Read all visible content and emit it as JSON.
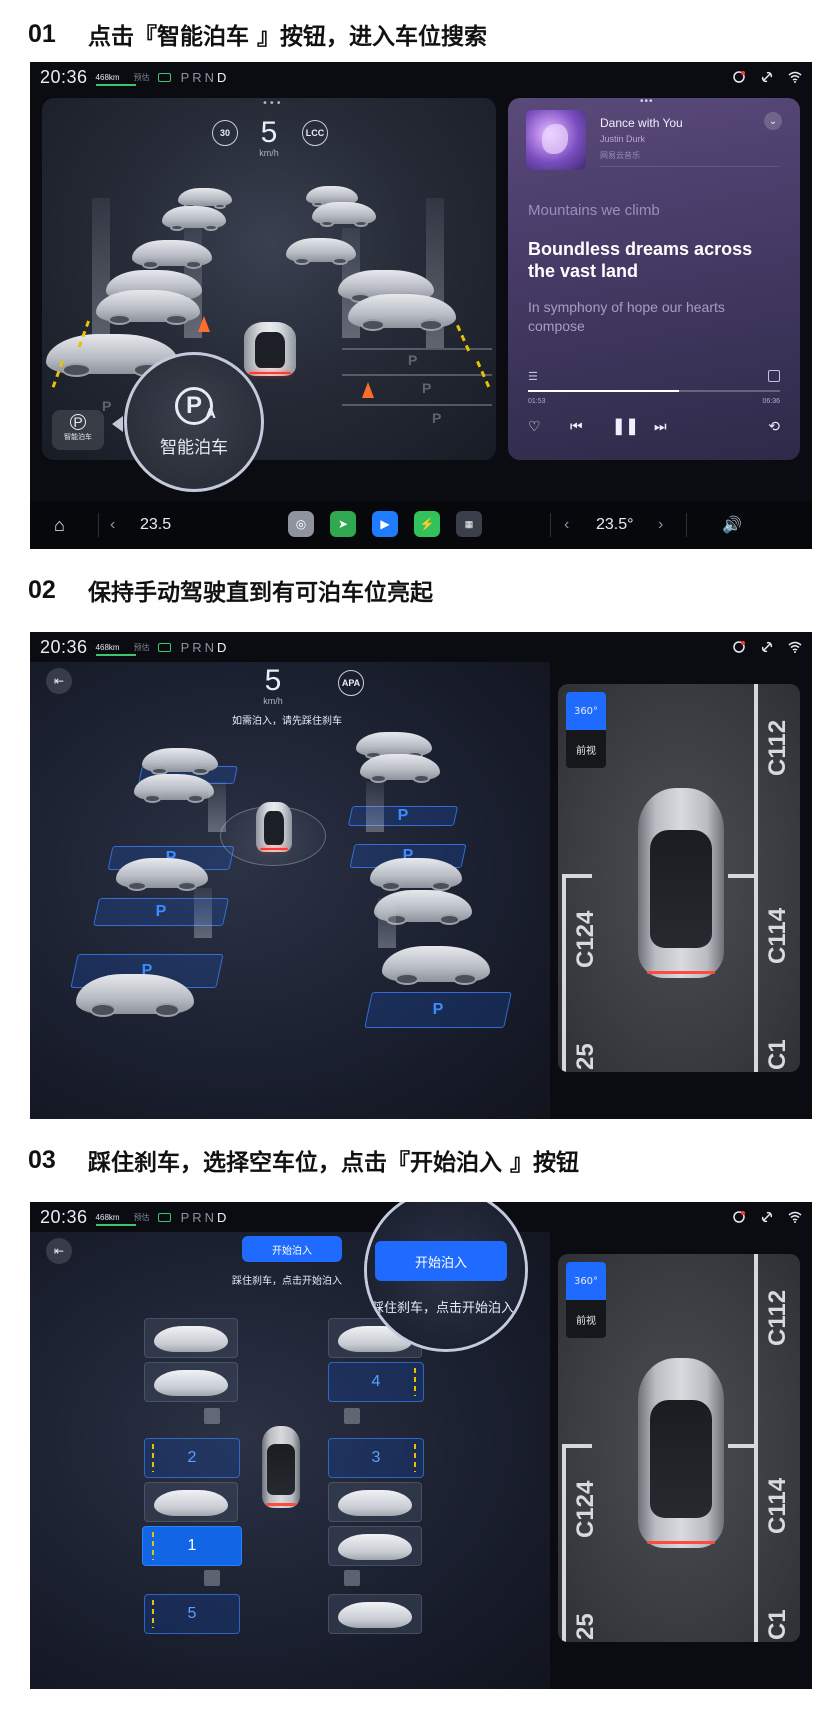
{
  "steps": [
    {
      "num": "01",
      "title": "点击『智能泊车 』按钮，进入车位搜索"
    },
    {
      "num": "02",
      "title": "保持手动驾驶直到有可泊车位亮起"
    },
    {
      "num": "03",
      "title": "踩住刹车，选择空车位，点击『开始泊入 』按钮"
    }
  ],
  "statusbar": {
    "clock": "20:36",
    "range": "468km",
    "estimate": "预估",
    "gears": [
      "P",
      "R",
      "N",
      "D"
    ],
    "active_gear": "D"
  },
  "screen1": {
    "speed": "5",
    "speed_unit": "km/h",
    "speed_limit": "30",
    "lcc_label": "LCC",
    "park_button_small_label": "智能泊车",
    "park_button_zoom_label": "智能泊车",
    "park_icon_letters": "P",
    "park_icon_sub": "A",
    "music": {
      "title": "Dance with You",
      "artist": "Justin Durk",
      "source": "网易云音乐",
      "lyric_prev": "Mountains we climb",
      "lyric_current": "Boundless dreams across the vast land",
      "lyric_next": "In symphony of hope our hearts compose",
      "elapsed": "01:53",
      "total": "06:36",
      "progress": 0.6
    },
    "bottom": {
      "temp_left": "23.5",
      "temp_right": "23.5°"
    }
  },
  "screen2": {
    "speed": "5",
    "speed_unit": "km/h",
    "apa_label": "APA",
    "hint": "如需泊入，请先踩住刹车",
    "cam_tab_360": "360°",
    "cam_tab_front": "前视",
    "cam_labels": [
      "C112",
      "C124",
      "C114",
      "25",
      "C1"
    ],
    "slot_letter": "P"
  },
  "screen3": {
    "start_button": "开始泊入",
    "hint": "踩住刹车，点击开始泊入",
    "zoom_button": "开始泊入",
    "zoom_hint": "踩住刹车，点击开始泊入",
    "cam_tab_360": "360°",
    "cam_tab_front": "前视",
    "cam_labels": [
      "C112",
      "C124",
      "C114",
      "25",
      "C1"
    ],
    "slots": [
      "4",
      "2",
      "3",
      "1",
      "5"
    ],
    "selected_slot": "1"
  }
}
